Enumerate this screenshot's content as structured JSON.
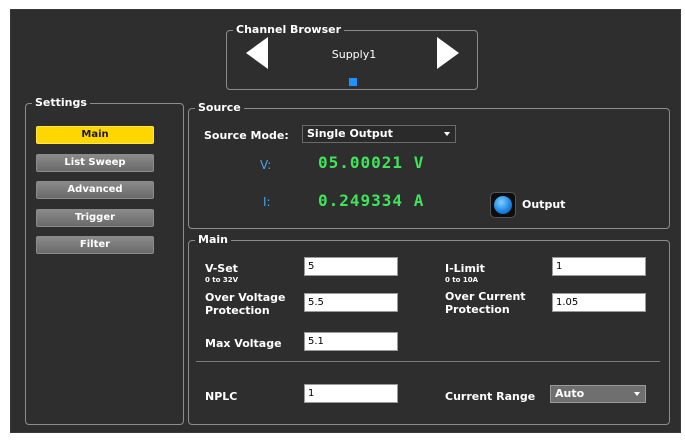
{
  "channel_browser": {
    "title": "Channel Browser",
    "channel_name": "Supply1",
    "indicator_color": "#1e90ff"
  },
  "settings": {
    "title": "Settings",
    "buttons": [
      {
        "label": "Main",
        "active": true
      },
      {
        "label": "List Sweep",
        "active": false
      },
      {
        "label": "Advanced",
        "active": false
      },
      {
        "label": "Trigger",
        "active": false
      },
      {
        "label": "Filter",
        "active": false
      }
    ]
  },
  "source": {
    "title": "Source",
    "mode_label": "Source Mode:",
    "mode_value": "Single Output",
    "voltage_label": "V:",
    "voltage_reading": "05.00021 V",
    "current_label": "I:",
    "current_reading": "0.249334 A",
    "output_label": "Output",
    "reading_color": "#3ee55a"
  },
  "main": {
    "title": "Main",
    "vset_label": "V-Set",
    "vset_range": "0 to 32V",
    "vset_value": "5",
    "ilimit_label": "I-Limit",
    "ilimit_range": "0 to 10A",
    "ilimit_value": "1",
    "ovp_label_line1": "Over Voltage",
    "ovp_label_line2": "Protection",
    "ovp_value": "5.5",
    "ocp_label_line1": "Over Current",
    "ocp_label_line2": "Protection",
    "ocp_value": "1.05",
    "maxv_label": "Max Voltage",
    "maxv_value": "5.1",
    "nplc_label": "NPLC",
    "nplc_value": "1",
    "current_range_label": "Current Range",
    "current_range_value": "Auto"
  },
  "colors": {
    "background": "#2e2e2e",
    "active_button": "#ffd700",
    "label_blue": "#4aa3e8"
  }
}
